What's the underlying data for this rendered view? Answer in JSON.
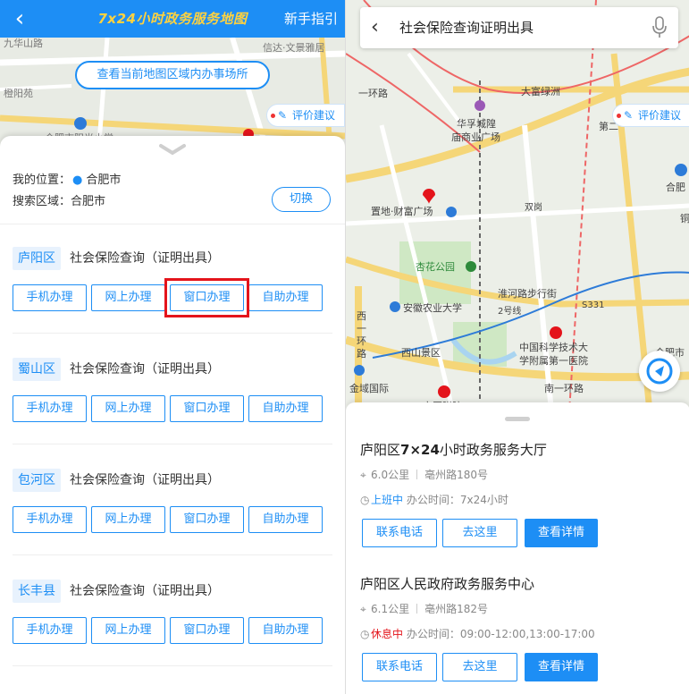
{
  "left": {
    "header": {
      "back_icon": "chevron-left-icon",
      "title": "7x24小时政务服务地图",
      "guide_label": "新手指引",
      "bg_color": "#1d8ef5",
      "title_color": "#ffd23f"
    },
    "map": {
      "labels": {
        "jiuhua": "九华山路",
        "xinda": "信达·文景雅居",
        "chengyang": "橙阳苑",
        "hefei_school": "合肥市阳光小学"
      },
      "view_button": "查看当前地图区域内办事场所",
      "rate_button": "评价建议"
    },
    "location": {
      "my_label": "我的位置：",
      "my_value": "合肥市",
      "search_label": "搜索区域：",
      "search_value": "合肥市",
      "switch_label": "切换"
    },
    "districts": [
      {
        "name": "庐阳区",
        "service": "社会保险查询（证明出具）",
        "buttons": [
          "手机办理",
          "网上办理",
          "窗口办理",
          "自助办理"
        ]
      },
      {
        "name": "蜀山区",
        "service": "社会保险查询（证明出具）",
        "buttons": [
          "手机办理",
          "网上办理",
          "窗口办理",
          "自助办理"
        ]
      },
      {
        "name": "包河区",
        "service": "社会保险查询（证明出具）",
        "buttons": [
          "手机办理",
          "网上办理",
          "窗口办理",
          "自助办理"
        ]
      },
      {
        "name": "长丰县",
        "service": "社会保险查询（证明出具）",
        "buttons": [
          "手机办理",
          "网上办理",
          "窗口办理",
          "自助办理"
        ]
      }
    ],
    "highlight_color": "#e4141b"
  },
  "right": {
    "search": {
      "query": "社会保险查询证明出具",
      "back_icon": "chevron-left-icon",
      "mic_icon": "microphone-icon"
    },
    "map": {
      "rate_button": "评价建议",
      "labels": {
        "yihuanlu": "一环路",
        "dafulvzhou": "大富绿洲",
        "huafucheng": "华孚城隍",
        "miaoshangye": "庙商业广场",
        "dier": "第二",
        "hefei_east": "合肥",
        "zhidi": "置地·财富广场",
        "shuanggang": "双岗",
        "xinghua": "杏花公园",
        "huaihe": "淮河路步行街",
        "s331": "S331",
        "anhui_agri": "安徽农业大学",
        "line2": "2号线",
        "xiyihuan_1": "西",
        "xiyihuan_2": "一",
        "xiyihuan_3": "环",
        "xiyihuan_4": "路",
        "xishan": "西山景区",
        "ustc_hosp1": "中国科学技术大",
        "ustc_hosp2": "学附属第一医院",
        "jinyu": "金域国际",
        "nanyihuan": "南一环路",
        "anyi": "安医附院",
        "jinfei": "今肥市",
        "bei": "铜"
      }
    },
    "places": [
      {
        "name_prefix": "庐阳区",
        "name_bold": "7×24",
        "name_suffix": "小时政务服务大厅",
        "distance": "6.0公里",
        "address": "亳州路180号",
        "status": "上班中",
        "hours": "办公时间：7x24小时",
        "actions": [
          "联系电话",
          "去这里",
          "查看详情"
        ]
      },
      {
        "name_prefix": "庐阳区人民政府政务服务中心",
        "name_bold": "",
        "name_suffix": "",
        "distance": "6.1公里",
        "address": "亳州路182号",
        "status": "休息中",
        "hours": "办公时间：09:00-12:00,13:00-17:00",
        "actions": [
          "联系电话",
          "去这里",
          "查看详情"
        ]
      }
    ]
  }
}
